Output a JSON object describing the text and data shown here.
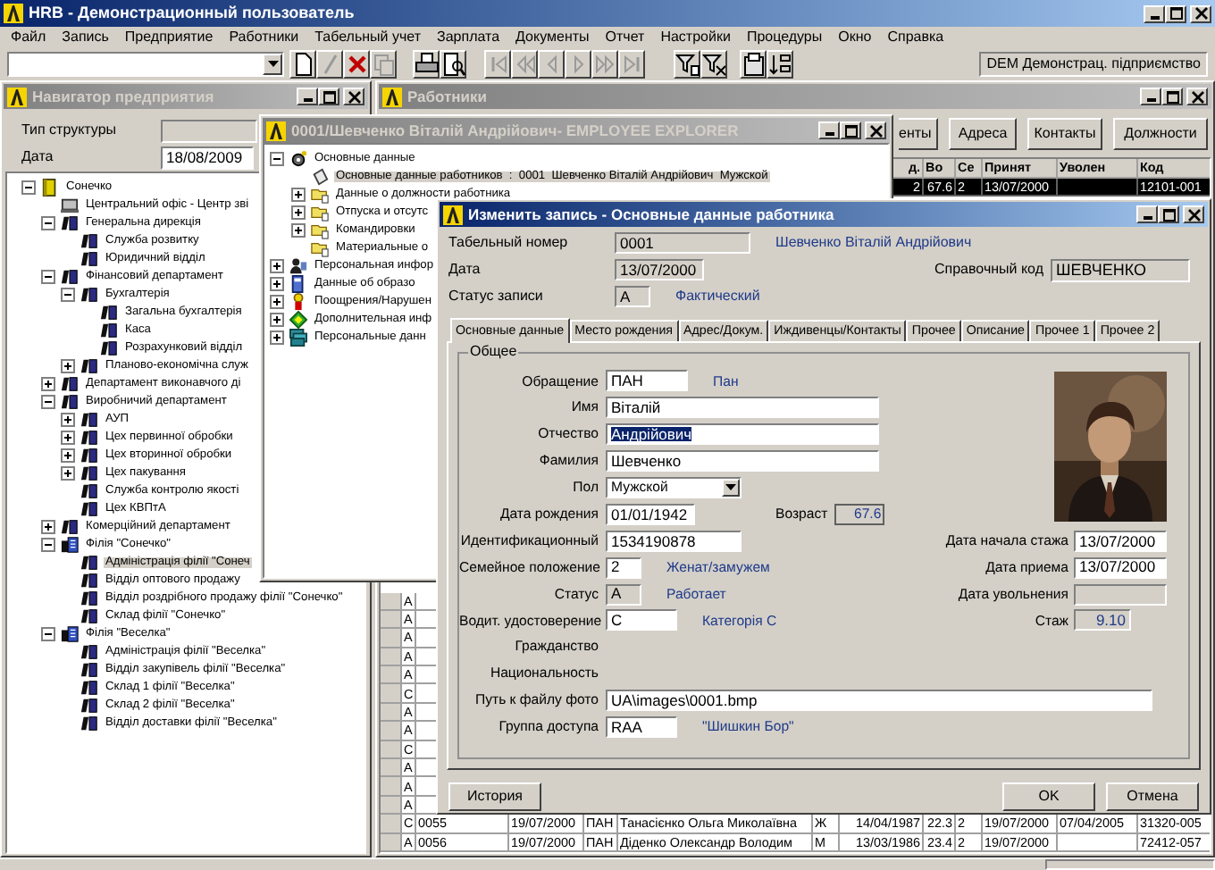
{
  "window": {
    "title": "HRB - Демонстрационный пользователь"
  },
  "menu": [
    "Файл",
    "Запись",
    "Предприятие",
    "Работники",
    "Табельный учет",
    "Зарплата",
    "Документы",
    "Отчет",
    "Настройки",
    "Процедуры",
    "Окно",
    "Справка"
  ],
  "toolbar": {
    "buttons": [
      {
        "kind": "new",
        "disabled": false
      },
      {
        "kind": "edit",
        "disabled": true
      },
      {
        "kind": "delete",
        "disabled": false
      },
      {
        "kind": "copy",
        "disabled": true
      },
      {
        "kind": "print",
        "disabled": false
      },
      {
        "kind": "preview",
        "disabled": false
      },
      {
        "kind": "first",
        "disabled": true
      },
      {
        "kind": "prev-page",
        "disabled": true
      },
      {
        "kind": "prev",
        "disabled": true
      },
      {
        "kind": "next",
        "disabled": true
      },
      {
        "kind": "next-page",
        "disabled": true
      },
      {
        "kind": "last",
        "disabled": true
      },
      {
        "kind": "filter",
        "disabled": false
      },
      {
        "kind": "clear-filter",
        "disabled": false
      },
      {
        "kind": "properties",
        "disabled": false
      },
      {
        "kind": "sort",
        "disabled": false
      }
    ],
    "company": "DEM Демонстрац. підприємство"
  },
  "navigator": {
    "title": "Навигатор предприятия",
    "structure_label": "Тип структуры",
    "date_label": "Дата",
    "date": "18/08/2009",
    "tree": [
      {
        "label": "Сонечко",
        "kind": "company",
        "expanded": true,
        "selected": false,
        "children": [
          {
            "label": "Центральний офіс - Центр зві",
            "kind": "office",
            "selected": false
          },
          {
            "label": "Генеральна дирекція",
            "kind": "department",
            "expanded": true,
            "selected": false,
            "children": [
              {
                "label": "Служба розвитку",
                "kind": "department",
                "selected": false
              },
              {
                "label": "Юридичний відділ",
                "kind": "department",
                "selected": false
              }
            ]
          },
          {
            "label": "Фінансовий департамент",
            "kind": "department",
            "expanded": true,
            "selected": false,
            "children": [
              {
                "label": "Бухгалтерія",
                "kind": "department",
                "expanded": true,
                "selected": false,
                "children": [
                  {
                    "label": "Загальна бухгалтерія",
                    "kind": "department",
                    "selected": false
                  },
                  {
                    "label": "Каса",
                    "kind": "department",
                    "selected": false
                  },
                  {
                    "label": "Розрахунковий відділ",
                    "kind": "department",
                    "selected": false
                  }
                ]
              },
              {
                "label": "Планово-економічна служ",
                "kind": "department",
                "expanded": false,
                "selected": false
              }
            ]
          },
          {
            "label": "Департамент виконавчого ді",
            "kind": "department",
            "expanded": false,
            "selected": false
          },
          {
            "label": "Виробничий департамент",
            "kind": "department",
            "expanded": true,
            "selected": false,
            "children": [
              {
                "label": "АУП",
                "kind": "department",
                "expanded": false,
                "selected": false
              },
              {
                "label": "Цех первинної обробки",
                "kind": "department",
                "expanded": false,
                "selected": false
              },
              {
                "label": "Цех вторинної обробки",
                "kind": "department",
                "expanded": false,
                "selected": false
              },
              {
                "label": "Цех пакування",
                "kind": "department",
                "expanded": false,
                "selected": false
              },
              {
                "label": "Служба контролю якості",
                "kind": "department",
                "selected": false
              },
              {
                "label": "Цех КВПтА",
                "kind": "department",
                "selected": false
              }
            ]
          },
          {
            "label": "Комерційний департамент",
            "kind": "department",
            "expanded": false,
            "selected": false
          },
          {
            "label": "Філія \"Сонечко\"",
            "kind": "branch",
            "expanded": true,
            "selected": false,
            "children": [
              {
                "label": "Адміністрація філії \"Сонеч",
                "kind": "department",
                "selected": true
              },
              {
                "label": "Відділ оптового продажу",
                "kind": "department",
                "selected": false
              },
              {
                "label": "Відділ роздрібного продажу філії \"Сонечко\"",
                "kind": "department",
                "selected": false
              },
              {
                "label": "Склад філії \"Сонечко\"",
                "kind": "department",
                "selected": false
              }
            ]
          },
          {
            "label": "Філія \"Веселка\"",
            "kind": "branch",
            "expanded": true,
            "selected": false,
            "children": [
              {
                "label": "Адміністрація філії \"Веселка\"",
                "kind": "department",
                "selected": false
              },
              {
                "label": "Відділ закупівель філії \"Веселка\"",
                "kind": "department",
                "selected": false
              },
              {
                "label": "Склад 1 філії \"Веселка\"",
                "kind": "department",
                "selected": false
              },
              {
                "label": "Склад 2 філії \"Веселка\"",
                "kind": "department",
                "selected": false
              },
              {
                "label": "Відділ доставки філії \"Веселка\"",
                "kind": "department",
                "selected": false
              }
            ]
          }
        ]
      }
    ]
  },
  "employees": {
    "title": "Работники",
    "buttons": [
      "енты",
      "Адреса",
      "Контакты",
      "Должности"
    ],
    "table": {
      "columns": {
        "column_7": "д.",
        "column_8": "Во",
        "column_9": "Се",
        "column_10": "Принят",
        "column_11": "Уволен",
        "column_12": "Код"
      },
      "rows": [
        {
          "column_7": "2",
          "column_8": "67.6",
          "column_9": "2",
          "column_10": "13/07/2000",
          "column_12": "12101-001",
          "selected": true
        },
        {
          "column_1": "A",
          "selected": false
        },
        {
          "column_1": "A",
          "selected": false
        },
        {
          "column_1": "A",
          "selected": false
        },
        {
          "column_1": "A",
          "selected": false
        },
        {
          "column_1": "A",
          "selected": false
        },
        {
          "column_1": "C",
          "selected": false
        },
        {
          "column_1": "A",
          "selected": false
        },
        {
          "column_1": "A",
          "selected": false
        },
        {
          "column_1": "C",
          "selected": false
        },
        {
          "column_1": "A",
          "selected": false
        },
        {
          "column_1": "A",
          "selected": false
        },
        {
          "column_1": "A",
          "selected": false
        },
        {
          "column_1": "C",
          "column_2": "0055",
          "column_3": "19/07/2000",
          "column_4": "ПАН",
          "column_5": "Танасієнко Ольга Миколаївна",
          "column_6": "Ж",
          "column_7": "14/04/1987",
          "column_8": "22.3",
          "column_9": "2",
          "column_10": "19/07/2000",
          "column_11": "07/04/2005",
          "column_12": "31320-005",
          "selected": false
        },
        {
          "column_1": "A",
          "column_2": "0056",
          "column_3": "19/07/2000",
          "column_4": "ПАН",
          "column_5": "Діденко Олександр Володим",
          "column_6": "М",
          "column_7": "13/03/1986",
          "column_8": "23.4",
          "column_9": "2",
          "column_10": "19/07/2000",
          "column_12": "72412-057",
          "selected": false
        }
      ]
    }
  },
  "explorer": {
    "title": "0001/Шевченко Віталій Андрійович- EMPLOYEE EXPLORER",
    "tree": [
      {
        "label": "Основные данные",
        "kind": "gear",
        "expanded": true,
        "selected": false,
        "children": [
          {
            "label": "Основные данные работников  :  0001  Шевченко Віталій Андрійович  Мужской",
            "kind": "doc",
            "selected": true
          },
          {
            "label": "Данные о должности работника",
            "kind": "folder",
            "expanded": false,
            "selected": false
          },
          {
            "label": "Отпуска и отсутс",
            "kind": "folder",
            "expanded": false,
            "selected": false
          },
          {
            "label": "Командировки",
            "kind": "folder",
            "expanded": false,
            "selected": false
          },
          {
            "label": "Материальные о",
            "kind": "folder",
            "selected": false
          }
        ]
      },
      {
        "label": "Персональная инфор",
        "kind": "card",
        "expanded": false,
        "selected": false
      },
      {
        "label": "Данные об образо",
        "kind": "book",
        "expanded": false,
        "selected": false
      },
      {
        "label": "Поощрения/Нарушен",
        "kind": "award",
        "expanded": false,
        "selected": false
      },
      {
        "label": "Дополнительная инф",
        "kind": "gem",
        "expanded": false,
        "selected": false
      },
      {
        "label": "Персональные данн",
        "kind": "stack",
        "expanded": false,
        "selected": false
      }
    ]
  },
  "dialog": {
    "title": "Изменить запись - Основные данные работника",
    "header": [
      {
        "label": "Табельный номер",
        "value": "0001",
        "note": "Шевченко Віталій Андрійович"
      },
      {
        "label": "Дата",
        "value": "13/07/2000"
      },
      {
        "label": "Статус записи",
        "value": "A",
        "note": "Фактический"
      }
    ],
    "reference": {
      "label": "Справочный код",
      "value": "ШЕВЧЕНКО"
    },
    "tabs": [
      {
        "label": "Основные данные",
        "selected": true
      },
      {
        "label": "Место рождения",
        "selected": false
      },
      {
        "label": "Адрес/Докум.",
        "selected": false
      },
      {
        "label": "Иждивенцы/Контакты",
        "selected": false
      },
      {
        "label": "Прочее",
        "selected": false
      },
      {
        "label": "Описание",
        "selected": false
      },
      {
        "label": "Прочее 1",
        "selected": false
      },
      {
        "label": "Прочее 2",
        "selected": false
      }
    ],
    "group": "Общее",
    "fields": [
      {
        "kind": "text",
        "label": "Обращение",
        "value": "ПАН",
        "note": "Пан",
        "readonly": false,
        "text_selected": false
      },
      {
        "kind": "text",
        "label": "Имя",
        "value": "Віталій",
        "readonly": false,
        "text_selected": false
      },
      {
        "kind": "text",
        "label": "Отчество",
        "value": "Андрійович",
        "readonly": false,
        "text_selected": true
      },
      {
        "kind": "text",
        "label": "Фамилия",
        "value": "Шевченко",
        "readonly": false,
        "text_selected": false
      },
      {
        "kind": "select",
        "label": "Пол",
        "value": "Мужской",
        "readonly": false
      },
      {
        "kind": "text",
        "label": "Дата рождения",
        "value": "01/01/1942",
        "readonly": false,
        "text_selected": false,
        "extra": {
          "label": "Возраст",
          "value": "67.6"
        }
      },
      {
        "kind": "text",
        "label": "Идентификационный",
        "value": "1534190878",
        "readonly": false,
        "text_selected": false
      },
      {
        "kind": "text",
        "label": "Семейное положение",
        "value": "2",
        "note": "Женат/замужем",
        "readonly": false,
        "text_selected": false
      },
      {
        "kind": "text",
        "label": "Статус",
        "value": "A",
        "note": "Работает",
        "readonly": true,
        "text_selected": false
      },
      {
        "kind": "text",
        "label": "Водит. удостоверение",
        "value": "C",
        "note": "Категорія С",
        "readonly": false,
        "text_selected": false
      },
      {
        "kind": "label",
        "label": "Гражданство"
      },
      {
        "kind": "label",
        "label": "Национальность"
      },
      {
        "kind": "text",
        "label": "Путь к файлу фото",
        "value": "UA\\images\\0001.bmp",
        "readonly": false,
        "text_selected": false
      },
      {
        "kind": "text",
        "label": "Группа доступа",
        "value": "RAA",
        "note": "\"Шишкин Бор\"",
        "readonly": false,
        "text_selected": false
      }
    ],
    "side_fields": [
      {
        "label": "Дата начала стажа",
        "value": "13/07/2000",
        "readonly": false
      },
      {
        "label": "Дата приема",
        "value": "13/07/2000",
        "readonly": false
      },
      {
        "label": "Дата увольнения",
        "readonly": true
      },
      {
        "label": "Стаж",
        "value": "9.10",
        "readonly": true
      }
    ],
    "photo": {
      "kind": "picture"
    },
    "buttons": [
      "История",
      "OK",
      "Отмена"
    ]
  }
}
